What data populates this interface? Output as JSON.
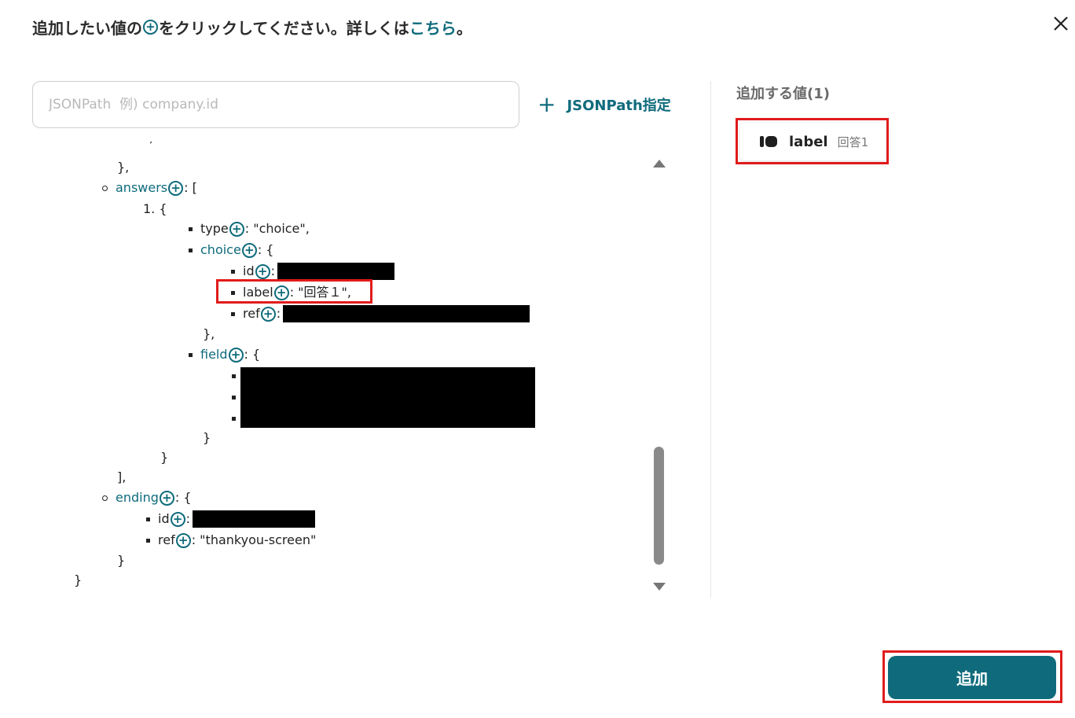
{
  "header": {
    "instruction_before": "追加したい値の",
    "instruction_after": "をクリックしてください。詳しくは",
    "link": "こちら",
    "end": "。"
  },
  "search": {
    "placeholder": "JSONPath  例) company.id"
  },
  "jsonpath_button": {
    "label": "JSONPath指定"
  },
  "tree": {
    "closing_obj": "},",
    "answers_key": "answers",
    "answers_suffix": ": [",
    "item_index": "1. {",
    "type_key": "type",
    "type_value": ": \"choice\",",
    "choice_key": "choice",
    "choice_suffix": ": {",
    "id_key": "id",
    "colon": ":",
    "label_key": "label",
    "label_value": ": \"回答１\",",
    "ref_key": "ref",
    "choice_close": "},",
    "field_key": "field",
    "field_suffix": ": {",
    "field_close": "}",
    "item_close": "}",
    "answers_close": "],",
    "ending_key": "ending",
    "ending_suffix": ": {",
    "ending_ref_value": ": \"thankyou-screen\"",
    "ending_close": "}",
    "root_close": "}"
  },
  "added_panel": {
    "title": "追加する値(1)",
    "items": [
      {
        "label": "label",
        "value": "回答1"
      }
    ]
  },
  "footer": {
    "add_label": "追加"
  },
  "colors": {
    "accent": "#0f6b7c",
    "highlight": "#e01b1b"
  }
}
